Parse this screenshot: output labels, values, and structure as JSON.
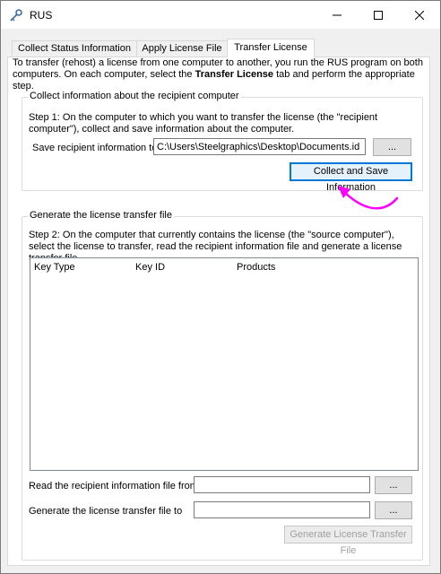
{
  "window": {
    "title": "RUS",
    "icon": "key-icon",
    "minimize_icon": "minimize-icon",
    "maximize_icon": "maximize-icon",
    "close_icon": "close-icon"
  },
  "tabs": [
    {
      "label": "Collect Status Information",
      "active": false
    },
    {
      "label": "Apply License File",
      "active": false
    },
    {
      "label": "Transfer License",
      "active": true
    }
  ],
  "intro": {
    "text_before": "To transfer (rehost) a license from one computer to another, you run the RUS program on both computers. On each computer, select the ",
    "bold": "Transfer License",
    "text_after": " tab and perform the appropriate step."
  },
  "collect_group": {
    "title": "Collect information about the recipient computer",
    "step": "Step 1: On the computer to which you want to transfer the license (the \"recipient computer\"), collect and save information about the computer.",
    "save_label": "Save recipient information to",
    "save_path": "C:\\Users\\Steelgraphics\\Desktop\\Documents.id",
    "browse_label": "...",
    "collect_button": "Collect and Save Information"
  },
  "generate_group": {
    "title": "Generate the license transfer file",
    "step": "Step 2: On the computer that currently contains the license (the \"source computer\"), select the license to transfer, read the recipient information file and generate a license transfer file.",
    "columns": [
      "Key Type",
      "Key ID",
      "Products"
    ],
    "rows": [],
    "read_label": "Read the recipient information file from",
    "read_path": "",
    "read_browse": "...",
    "generate_label": "Generate the license transfer file to",
    "generate_path": "",
    "generate_browse": "...",
    "generate_button": "Generate License Transfer File",
    "generate_button_enabled": false
  },
  "annotation": {
    "arrow_color": "#ff00ff"
  }
}
